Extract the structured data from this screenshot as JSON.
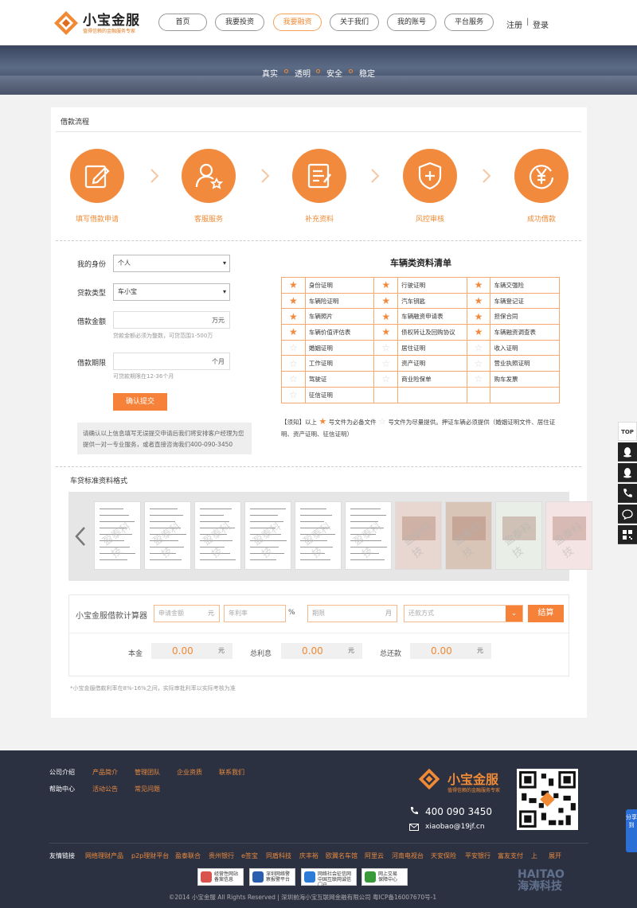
{
  "header": {
    "logo_name": "小宝金服",
    "logo_slogan": "值得信赖的金融服务专家",
    "nav": [
      "首页",
      "我要投资",
      "我要融资",
      "关于我们",
      "我的账号",
      "平台服务"
    ],
    "active_nav": "我要融资",
    "register": "注册",
    "divider": "|",
    "login": "登录",
    "accent": "#f08a34"
  },
  "banner": {
    "words": [
      "真实",
      "透明",
      "安全",
      "稳定"
    ]
  },
  "process": {
    "title": "借款流程",
    "steps": [
      {
        "label": "填写借款申请",
        "icon": "edit-icon"
      },
      {
        "label": "客服服务",
        "icon": "service-user-icon"
      },
      {
        "label": "补充资料",
        "icon": "document-icon"
      },
      {
        "label": "风控审核",
        "icon": "shield-icon"
      },
      {
        "label": "成功借款",
        "icon": "yen-coin-icon"
      }
    ]
  },
  "form": {
    "identity_label": "我的身份",
    "identity_value": "个人",
    "type_label": "贷款类型",
    "type_value": "车小宝",
    "amount_label": "借款金额",
    "amount_unit": "万元",
    "amount_hint": "贷款金额必须为整数，可贷范围1-500万",
    "term_label": "借款期限",
    "term_unit": "个月",
    "term_hint": "可贷款期限在12-36个月",
    "submit": "确认提交",
    "notice": "请确认以上信息填写无误提交申请后我们将安排客户经理为您提供一对一专业服务，或者直接咨询我们400-090-3450"
  },
  "materials": {
    "title": "车辆类资料清单",
    "rows": [
      [
        {
          "text": "身份证明",
          "star": "full"
        },
        {
          "text": "行驶证明",
          "star": "full"
        },
        {
          "text": "车辆交强险",
          "star": "full"
        }
      ],
      [
        {
          "text": "车辆险证明",
          "star": "full"
        },
        {
          "text": "汽车钥匙",
          "star": "full"
        },
        {
          "text": "车辆登记证",
          "star": "full"
        }
      ],
      [
        {
          "text": "车辆照片",
          "star": "full"
        },
        {
          "text": "车辆融资申请表",
          "star": "full"
        },
        {
          "text": "担保合同",
          "star": "full"
        }
      ],
      [
        {
          "text": "车辆价值评估表",
          "star": "full"
        },
        {
          "text": "债权转让及回购协议",
          "star": "full"
        },
        {
          "text": "车辆融资调查表",
          "star": "full"
        }
      ],
      [
        {
          "text": "婚姻证明",
          "star": "empty"
        },
        {
          "text": "居住证明",
          "star": "empty"
        },
        {
          "text": "收入证明",
          "star": "empty"
        }
      ],
      [
        {
          "text": "工作证明",
          "star": "empty"
        },
        {
          "text": "资产证明",
          "star": "empty"
        },
        {
          "text": "营业执照证明",
          "star": "empty"
        }
      ],
      [
        {
          "text": "驾驶证",
          "star": "empty"
        },
        {
          "text": "商业险保单",
          "star": "empty"
        },
        {
          "text": "购车发票",
          "star": "empty"
        }
      ],
      [
        {
          "text": "征信证明",
          "star": "empty"
        },
        {
          "text": "",
          "star": "none"
        },
        {
          "text": "",
          "star": "none"
        }
      ]
    ],
    "note_prefix": "【须知】以上",
    "note_required": "号文件为必备文件",
    "note_optional": "号文件为尽量提供。押证车辆必须提供（婚姻证明文件、居住证明、资产证明、征信证明）"
  },
  "samples": {
    "title": "车贷标准资料格式",
    "watermark": "盈泰科技",
    "count": 10
  },
  "calculator": {
    "title": "小宝金服借款计算器",
    "amount_placeholder": "申请金额",
    "amount_unit": "元",
    "rate_placeholder": "年利率",
    "rate_unit": "%",
    "term_placeholder": "期限",
    "term_unit": "月",
    "method_placeholder": "还款方式",
    "button": "结算",
    "results": [
      {
        "label": "本金",
        "value": "0.00",
        "unit": "元"
      },
      {
        "label": "总利息",
        "value": "0.00",
        "unit": "元"
      },
      {
        "label": "总还款",
        "value": "0.00",
        "unit": "元"
      }
    ],
    "note": "*小宝金服借款利率在8%-16%之间，实际审批利率以实际考核为准"
  },
  "footer": {
    "row1": [
      "公司介绍",
      "产品简介",
      "管理团队",
      "企业资质",
      "联系我们"
    ],
    "row2": [
      "帮助中心",
      "活动公告",
      "常见问题"
    ],
    "logo_name": "小宝金服",
    "logo_slogan": "值得信赖的金融服务专家",
    "phone": "400 090 3450",
    "email": "xiaobao@19jf.cn",
    "links_label": "友情链接",
    "links": [
      "网络理财产品",
      "p2p理财平台",
      "盈泰联合",
      "贵州银行",
      "e签宝",
      "同盾科技",
      "庆丰裕",
      "欧翼名车馆",
      "阿里云",
      "河南电视台",
      "天安保险",
      "平安银行",
      "富友支付",
      "上",
      "展开"
    ],
    "badges": [
      {
        "l1": "经营性网站",
        "l2": "备案信息",
        "color": "#d9534f"
      },
      {
        "l1": "深圳网络警",
        "l2": "察报警平台",
        "color": "#2a5fb0"
      },
      {
        "l1": "网络社会征信网",
        "l2": "中国互联网诚信门户",
        "color": "#2c7bd6"
      },
      {
        "l1": "网上交易",
        "l2": "保障中心",
        "color": "#3a9a3a"
      }
    ],
    "copyright": "©2014 小宝金服 All Rights Reserved | 深圳前海小宝互联网金融有限公司 粤ICP备16007670号-1"
  },
  "float_bar": {
    "top": "TOP"
  },
  "share": "分享到",
  "watermark": {
    "l1": "HAITAO",
    "l2": "海涛科技"
  }
}
